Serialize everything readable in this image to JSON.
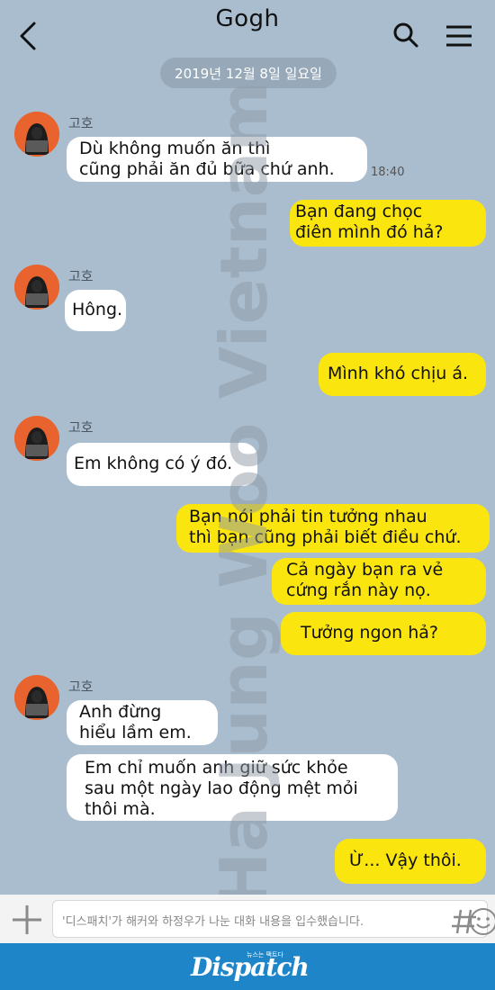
{
  "header": {
    "title": "Gogh",
    "date": "2019년 12월  8일 일요일"
  },
  "icons": {
    "back": "chevron-left-icon",
    "search": "search-icon",
    "menu": "hamburger-menu-icon",
    "plus": "plus-icon",
    "emoji": "emoji-icon",
    "hash": "hashtag-icon"
  },
  "colors": {
    "background": "#a9bdce",
    "outgoing_bubble": "#fbe50f",
    "incoming_bubble": "#ffffff",
    "avatar": "#e8632e",
    "footer": "#1e86c8"
  },
  "conversation": {
    "sender_name": "고호",
    "m1": "Dù không muốn ăn thì\ncũng phải ăn đủ bữa chứ anh.",
    "m1_time": "18:40",
    "m2": "Bạn đang chọc\nđiên mình đó hả?",
    "m3": "Hông.",
    "m4": "Mình khó chịu á.",
    "m5": "Em không có ý đó.",
    "m6": "Bạn nói phải tin tưởng nhau\nthì bạn cũng phải biết điều chứ.",
    "m7": "Cả ngày bạn ra vẻ\ncứng rắn này nọ.",
    "m8": "Tưởng ngon hả?",
    "m9": "Anh đừng\nhiểu lầm em.",
    "m10": "Em chỉ muốn anh giữ sức khỏe\nsau một ngày lao động mệt mỏi\nthôi mà.",
    "m11": "Ừ... Vậy thôi."
  },
  "input": {
    "placeholder": "'디스패치'가 해커와 하정우가 나눈 대화 내용을 입수했습니다."
  },
  "watermark": "Ha Jung Woo Vietnam",
  "footer": {
    "brand": "Dispatch",
    "tagline": "뉴스는 팩트다"
  }
}
